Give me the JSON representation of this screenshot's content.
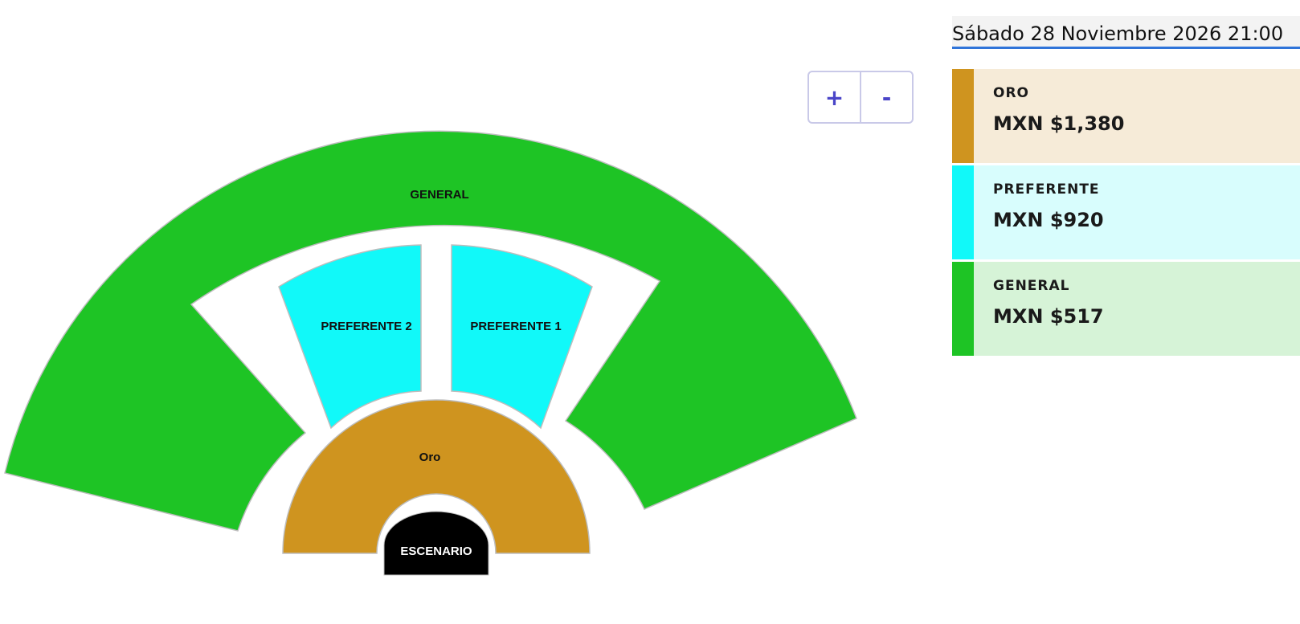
{
  "venue_map": {
    "sections": [
      {
        "id": "general",
        "label": "GENERAL",
        "color": "#1ec425"
      },
      {
        "id": "preferente-2",
        "label": "PREFERENTE 2",
        "color": "#11f9f9"
      },
      {
        "id": "preferente-1",
        "label": "PREFERENTE 1",
        "color": "#11f9f9"
      },
      {
        "id": "oro",
        "label": "Oro",
        "color": "#cf941f"
      },
      {
        "id": "escenario",
        "label": "ESCENARIO",
        "color": "#000000"
      }
    ]
  },
  "zoom": {
    "in_label": "+",
    "out_label": "-"
  },
  "event": {
    "date": "Sábado 28 Noviembre 2026 21:00"
  },
  "prices": [
    {
      "name": "ORO",
      "amount": "MXN $1,380",
      "color": "#cf941f",
      "background": "#f6ebd8"
    },
    {
      "name": "PREFERENTE",
      "amount": "MXN $920",
      "color": "#11f9f9",
      "background": "#d8fdfd"
    },
    {
      "name": "GENERAL",
      "amount": "MXN $517",
      "color": "#1ec425",
      "background": "#d6f3d7"
    }
  ]
}
